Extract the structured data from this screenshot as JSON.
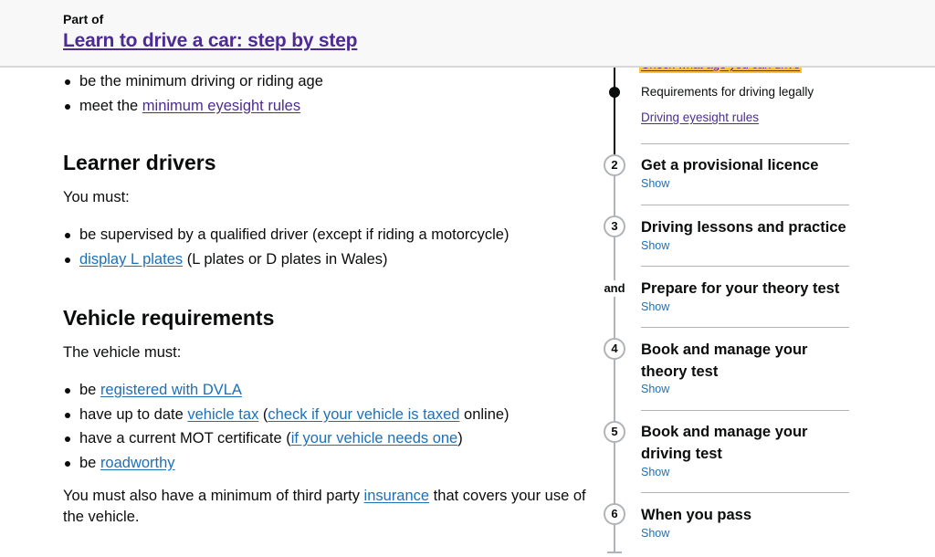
{
  "header": {
    "part_of_label": "Part of",
    "title_link": "Learn to drive a car: step by step"
  },
  "main": {
    "intro_list": [
      {
        "text": "be the minimum driving or riding age"
      },
      {
        "prefix": "meet the ",
        "link": "minimum eyesight rules"
      }
    ],
    "learner": {
      "heading": "Learner drivers",
      "lead": "You must:",
      "items": [
        {
          "text": "be supervised by a qualified driver (except if riding a motorcycle)"
        },
        {
          "link": "display L plates",
          "suffix": " (L plates or D plates in Wales)"
        }
      ]
    },
    "vehicle": {
      "heading": "Vehicle requirements",
      "lead": "The vehicle must:",
      "items": [
        {
          "prefix": "be ",
          "link": "registered with DVLA"
        },
        {
          "prefix": "have up to date ",
          "link": "vehicle tax",
          "mid": " (",
          "link2": "check if your vehicle is taxed",
          "suffix": " online)"
        },
        {
          "prefix": "have a current MOT certificate (",
          "link": "if your vehicle needs one",
          "suffix": ")"
        },
        {
          "prefix": "be ",
          "link": "roadworthy"
        }
      ],
      "footer_prefix": "You must also have a minimum of third party ",
      "footer_link": "insurance",
      "footer_suffix": " that covers your use of the vehicle."
    }
  },
  "stepnav": {
    "highlight_link": "Check what age you can drive",
    "current_item": "Requirements for driving legally",
    "sub_link": "Driving eyesight rules",
    "steps": [
      {
        "number": "2",
        "title": "Get a provisional licence",
        "toggle": "Show"
      },
      {
        "number": "3",
        "title": "Driving lessons and practice",
        "toggle": "Show"
      },
      {
        "number": "and",
        "title": "Prepare for your theory test",
        "toggle": "Show"
      },
      {
        "number": "4",
        "title": "Book and manage your theory test",
        "toggle": "Show"
      },
      {
        "number": "5",
        "title": "Book and manage your driving test",
        "toggle": "Show"
      },
      {
        "number": "6",
        "title": "When you pass",
        "toggle": "Show"
      }
    ]
  },
  "colors": {
    "link": "#1d70b8",
    "visited_link": "#4c2c92",
    "focus_highlight": "#fdc13f",
    "text": "#0b0c0c",
    "header_bg": "#f8f8f8"
  }
}
